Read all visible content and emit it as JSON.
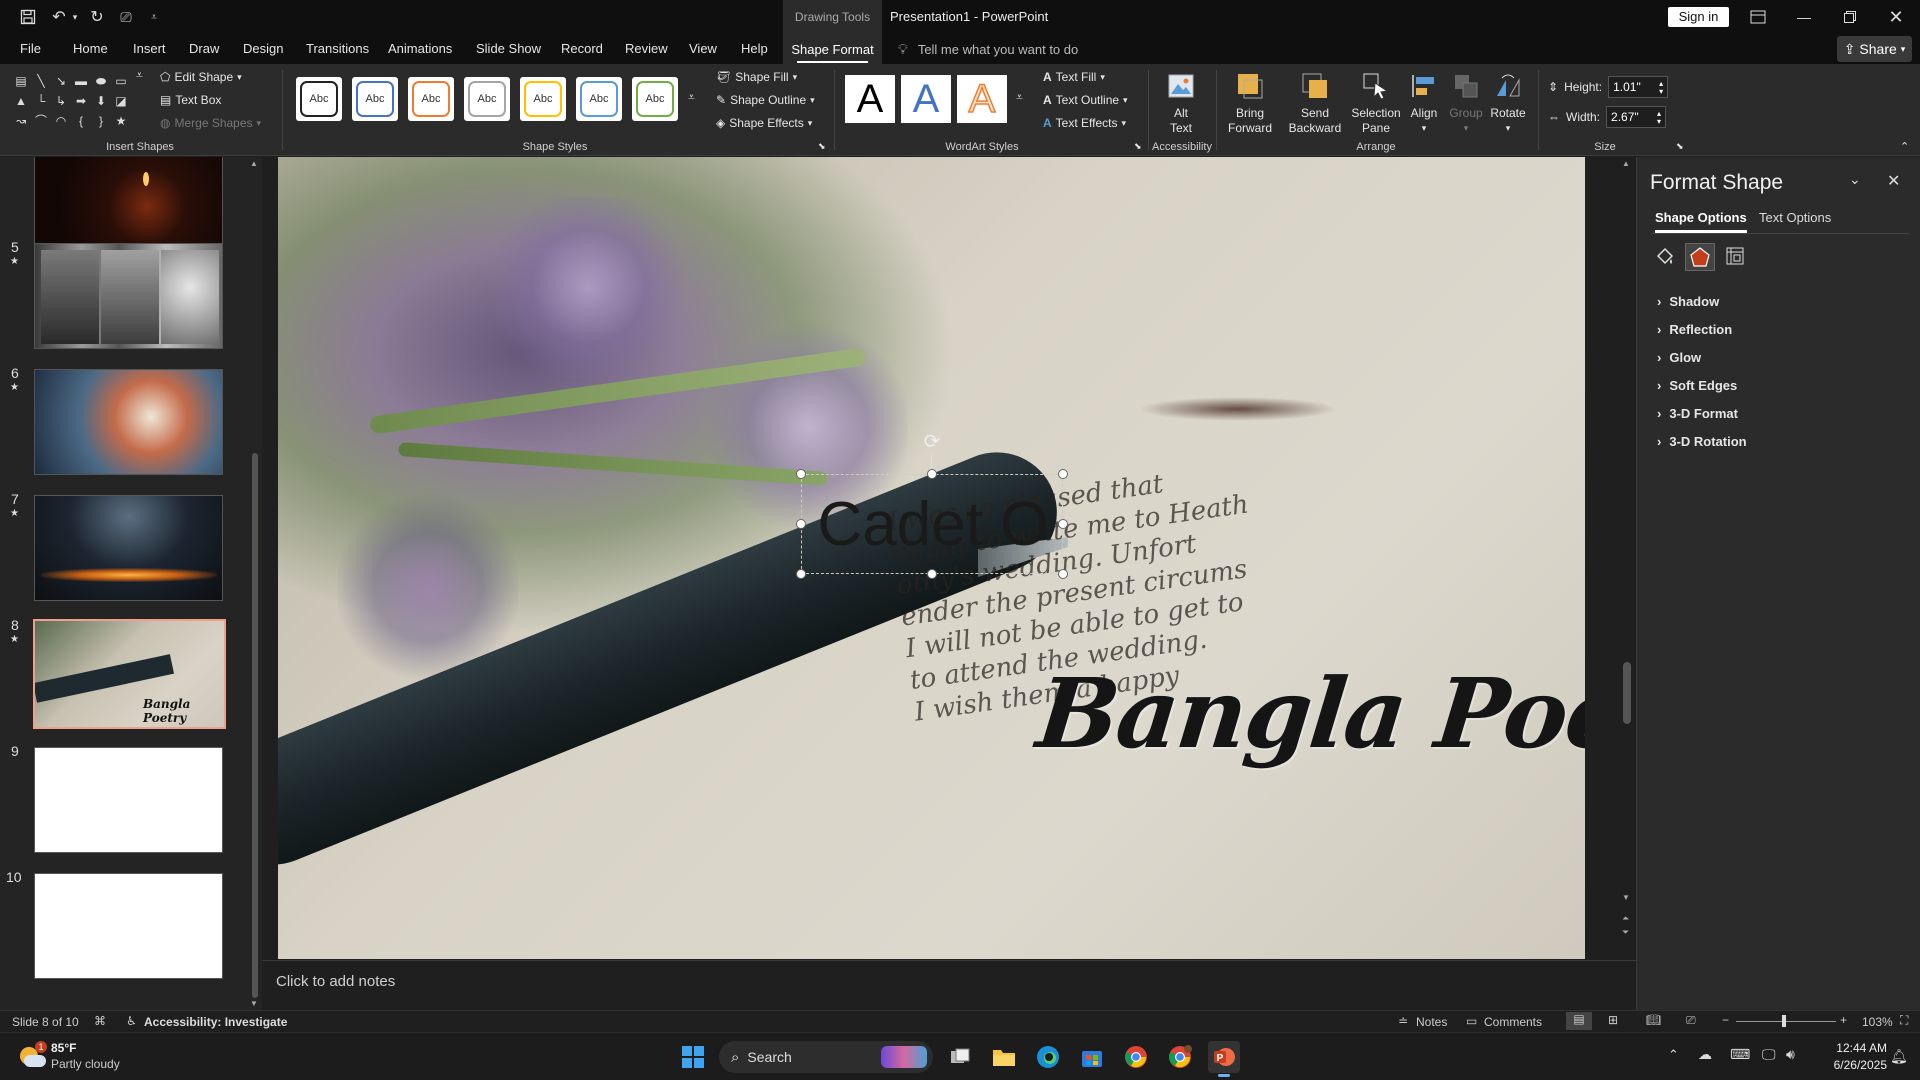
{
  "window": {
    "context_label": "Drawing Tools",
    "title": "Presentation1  -  PowerPoint",
    "signin": "Sign in",
    "share": "Share"
  },
  "tabs": [
    "File",
    "Home",
    "Insert",
    "Draw",
    "Design",
    "Transitions",
    "Animations",
    "Slide Show",
    "Record",
    "Review",
    "View",
    "Help"
  ],
  "active_tab": "Shape Format",
  "tell_me": "Tell me what you want to do",
  "ribbon": {
    "insert_shapes": {
      "label": "Insert Shapes",
      "edit_shape": "Edit Shape",
      "text_box": "Text Box",
      "merge_shapes": "Merge Shapes"
    },
    "shape_styles": {
      "label": "Shape Styles",
      "sample": "Abc",
      "fill": "Shape Fill",
      "outline": "Shape Outline",
      "effects": "Shape Effects"
    },
    "wordart": {
      "label": "WordArt Styles",
      "sample": "A",
      "text_fill": "Text Fill",
      "text_outline": "Text Outline",
      "text_effects": "Text Effects"
    },
    "accessibility": {
      "label": "Accessibility",
      "alt_text_1": "Alt",
      "alt_text_2": "Text"
    },
    "arrange": {
      "label": "Arrange",
      "bring_forward_1": "Bring",
      "bring_forward_2": "Forward",
      "send_backward_1": "Send",
      "send_backward_2": "Backward",
      "selection_pane_1": "Selection",
      "selection_pane_2": "Pane",
      "align": "Align",
      "group": "Group",
      "rotate": "Rotate"
    },
    "size": {
      "label": "Size",
      "height_label": "Height:",
      "height_value": "1.01\"",
      "width_label": "Width:",
      "width_value": "2.67\""
    }
  },
  "thumbnails": [
    {
      "num": "5",
      "star": "★"
    },
    {
      "num": "6",
      "star": "★"
    },
    {
      "num": "7",
      "star": "★"
    },
    {
      "num": "8",
      "star": "★",
      "caption": "Bangla Poetry"
    },
    {
      "num": "9"
    },
    {
      "num": "10"
    }
  ],
  "slide": {
    "textbox": "Cadet O",
    "title": "Bangla Poetry",
    "handwriting": [
      "I was so pleased that",
      "ought to write me to Heath",
      "othy's wedding. Unfort",
      "ender the present circums",
      "I will not be able to get to",
      "to attend the wedding.",
      "I wish them a happy"
    ]
  },
  "notes_placeholder": "Click to add notes",
  "pane": {
    "title": "Format Shape",
    "tab_shape": "Shape Options",
    "tab_text": "Text Options",
    "sections": [
      "Shadow",
      "Reflection",
      "Glow",
      "Soft Edges",
      "3-D Format",
      "3-D Rotation"
    ]
  },
  "status": {
    "slide_info": "Slide 8 of 10",
    "accessibility": "Accessibility: Investigate",
    "notes": "Notes",
    "comments": "Comments",
    "zoom": "103%"
  },
  "taskbar": {
    "temperature": "85°F",
    "weather": "Partly cloudy",
    "weather_badge": "1",
    "search": "Search",
    "time": "12:44 AM",
    "date": "6/26/2025"
  },
  "colors": {
    "accent_orange": "#c43e1c",
    "selection_border": "#f0a08a",
    "background_dark": "#1f1f1f",
    "ribbon": "#2b2b2b"
  }
}
